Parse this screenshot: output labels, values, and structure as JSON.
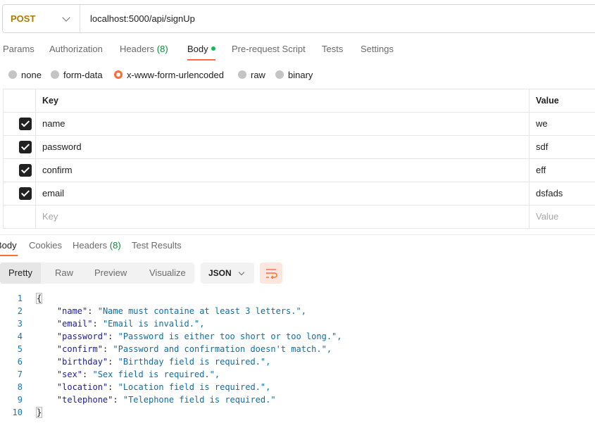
{
  "request": {
    "method": "POST",
    "url": "localhost:5000/api/signUp"
  },
  "request_tabs": [
    {
      "label": "Params"
    },
    {
      "label": "Authorization"
    },
    {
      "label": "Headers",
      "count": "(8)"
    },
    {
      "label": "Body",
      "active": true
    },
    {
      "label": "Pre-request Script"
    },
    {
      "label": "Tests"
    },
    {
      "label": "Settings"
    }
  ],
  "body_types": [
    "none",
    "form-data",
    "x-www-form-urlencoded",
    "raw",
    "binary"
  ],
  "body_type_selected": "x-www-form-urlencoded",
  "params_table": {
    "headers": {
      "key": "Key",
      "value": "Value"
    },
    "rows": [
      {
        "key": "name",
        "value": "we",
        "checked": true
      },
      {
        "key": "password",
        "value": "sdf",
        "checked": true
      },
      {
        "key": "confirm",
        "value": "eff",
        "checked": true
      },
      {
        "key": "email",
        "value": "dsfads",
        "checked": true
      }
    ],
    "placeholder": {
      "key": "Key",
      "value": "Value"
    }
  },
  "response_tabs": [
    {
      "label": "Body",
      "active": true
    },
    {
      "label": "Cookies"
    },
    {
      "label": "Headers",
      "count": "(8)"
    },
    {
      "label": "Test Results"
    }
  ],
  "view_options": [
    "Pretty",
    "Raw",
    "Preview",
    "Visualize"
  ],
  "format": "JSON",
  "code_lines": [
    {
      "n": "1",
      "text": "{"
    },
    {
      "n": "2",
      "key": "\"name\"",
      "value": "\"Name must containe at least 3 letters.\","
    },
    {
      "n": "3",
      "key": "\"email\"",
      "value": "\"Email is invalid.\","
    },
    {
      "n": "4",
      "key": "\"password\"",
      "value": "\"Password is either too short or too long.\","
    },
    {
      "n": "5",
      "key": "\"confirm\"",
      "value": "\"Password and confirmation doesn't match.\","
    },
    {
      "n": "6",
      "key": "\"birthday\"",
      "value": "\"Birthday field is required.\","
    },
    {
      "n": "7",
      "key": "\"sex\"",
      "value": "\"Sex field is required.\","
    },
    {
      "n": "8",
      "key": "\"location\"",
      "value": "\"Location field is required.\","
    },
    {
      "n": "9",
      "key": "\"telephone\"",
      "value": "\"Telephone field is required.\""
    },
    {
      "n": "10",
      "text": "}"
    }
  ],
  "colors": {
    "accent": "#ff6c37",
    "method": "#ad7a03",
    "count": "#0b8a3a"
  }
}
